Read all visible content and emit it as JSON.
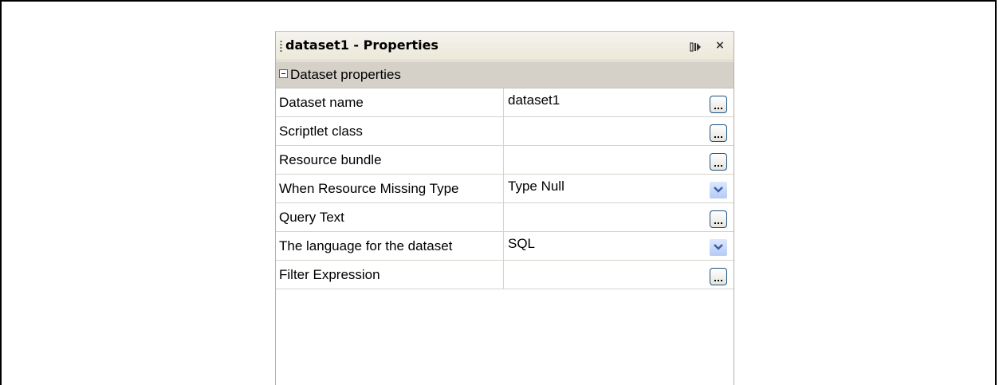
{
  "panel": {
    "title": "dataset1 - Properties",
    "maximize_icon": "restore-panel-icon",
    "close_label": "×"
  },
  "category": {
    "label": "Dataset properties",
    "expanded": true
  },
  "properties": [
    {
      "name": "Dataset name",
      "value": "dataset1",
      "editor": "ellipsis"
    },
    {
      "name": "Scriptlet class",
      "value": "",
      "editor": "ellipsis"
    },
    {
      "name": "Resource bundle",
      "value": "",
      "editor": "ellipsis"
    },
    {
      "name": "When Resource Missing Type",
      "value": "Type Null",
      "editor": "dropdown"
    },
    {
      "name": "Query Text",
      "value": "",
      "editor": "ellipsis"
    },
    {
      "name": "The language for the dataset",
      "value": "SQL",
      "editor": "dropdown"
    },
    {
      "name": "Filter Expression",
      "value": "",
      "editor": "ellipsis"
    }
  ],
  "colors": {
    "titlebar": "#ece9d8",
    "category_bg": "#d5d0c8",
    "grid_line": "#d6d3ca",
    "dropdown_blue": "#b5cbf5",
    "button_border": "#1c5180"
  }
}
